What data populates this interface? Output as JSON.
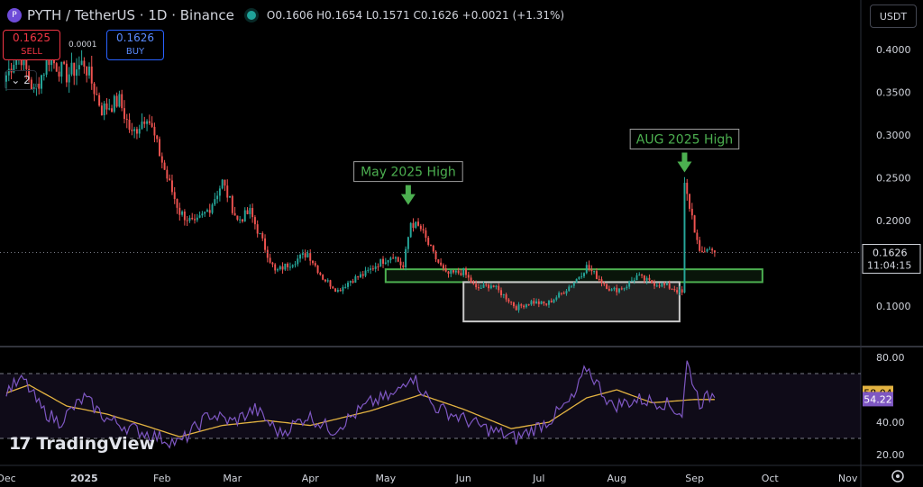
{
  "header": {
    "symbol": "PYTH / TetherUS · 1D · Binance",
    "ohlc": "O0.1606 H0.1654 L0.1571 C0.1626 +0.0021 (+1.31%)"
  },
  "currency_selector": "USDT",
  "sell": {
    "price": "0.1625",
    "label": "SELL"
  },
  "buy": {
    "price": "0.1626",
    "label": "BUY"
  },
  "spread": "0.0001",
  "indicator_count": "2",
  "collapse_icon": "chevron-down-icon",
  "watermark": "TradingView",
  "colors": {
    "up": "#26a69a",
    "down": "#ef5350",
    "rsi": "#7e57c2",
    "rsi_ma": "#e3b341",
    "annotation": "#4caf50",
    "box_green": "#4caf50",
    "box_gray": "#c8c8c8"
  },
  "chart_data": [
    {
      "type": "candlestick",
      "x_ticks": [
        "Dec",
        "2025",
        "Feb",
        "Mar",
        "Apr",
        "May",
        "Jun",
        "Jul",
        "Aug",
        "Sep",
        "Oct",
        "Nov"
      ],
      "y_ticks": [
        "0.4000",
        "0.3500",
        "0.3000",
        "0.2500",
        "0.2000",
        "0.1000"
      ],
      "ylim": [
        0.07,
        0.43
      ],
      "last_price": "0.1626",
      "countdown": "11:04:15",
      "annotations": [
        {
          "text": "May 2025 High",
          "date": "2025-05-10",
          "price": 0.212
        },
        {
          "text": "AUG 2025 High",
          "date": "2025-08-28",
          "price": 0.25
        }
      ],
      "zones": [
        {
          "color": "green",
          "from": "2025-05-01",
          "to": "2025-09-28",
          "low": 0.128,
          "high": 0.143
        },
        {
          "color": "gray",
          "from": "2025-06-01",
          "to": "2025-08-26",
          "low": 0.082,
          "high": 0.128
        }
      ],
      "price_path": [
        {
          "date": "2024-12-01",
          "price": 0.37
        },
        {
          "date": "2024-12-06",
          "price": 0.4
        },
        {
          "date": "2024-12-12",
          "price": 0.35
        },
        {
          "date": "2024-12-18",
          "price": 0.39
        },
        {
          "date": "2024-12-25",
          "price": 0.37
        },
        {
          "date": "2025-01-01",
          "price": 0.385
        },
        {
          "date": "2025-01-08",
          "price": 0.33
        },
        {
          "date": "2025-01-15",
          "price": 0.34
        },
        {
          "date": "2025-01-20",
          "price": 0.3
        },
        {
          "date": "2025-01-26",
          "price": 0.325
        },
        {
          "date": "2025-02-03",
          "price": 0.25
        },
        {
          "date": "2025-02-08",
          "price": 0.21
        },
        {
          "date": "2025-02-14",
          "price": 0.195
        },
        {
          "date": "2025-02-20",
          "price": 0.215
        },
        {
          "date": "2025-02-25",
          "price": 0.245
        },
        {
          "date": "2025-03-03",
          "price": 0.2
        },
        {
          "date": "2025-03-08",
          "price": 0.21
        },
        {
          "date": "2025-03-13",
          "price": 0.175
        },
        {
          "date": "2025-03-18",
          "price": 0.14
        },
        {
          "date": "2025-03-24",
          "price": 0.15
        },
        {
          "date": "2025-03-31",
          "price": 0.162
        },
        {
          "date": "2025-04-06",
          "price": 0.133
        },
        {
          "date": "2025-04-12",
          "price": 0.118
        },
        {
          "date": "2025-04-17",
          "price": 0.13
        },
        {
          "date": "2025-04-23",
          "price": 0.138
        },
        {
          "date": "2025-04-28",
          "price": 0.15
        },
        {
          "date": "2025-05-04",
          "price": 0.16
        },
        {
          "date": "2025-05-08",
          "price": 0.145
        },
        {
          "date": "2025-05-11",
          "price": 0.198
        },
        {
          "date": "2025-05-15",
          "price": 0.19
        },
        {
          "date": "2025-05-20",
          "price": 0.16
        },
        {
          "date": "2025-05-25",
          "price": 0.137
        },
        {
          "date": "2025-06-01",
          "price": 0.14
        },
        {
          "date": "2025-06-06",
          "price": 0.12
        },
        {
          "date": "2025-06-12",
          "price": 0.125
        },
        {
          "date": "2025-06-18",
          "price": 0.11
        },
        {
          "date": "2025-06-22",
          "price": 0.098
        },
        {
          "date": "2025-06-28",
          "price": 0.105
        },
        {
          "date": "2025-07-04",
          "price": 0.102
        },
        {
          "date": "2025-07-10",
          "price": 0.115
        },
        {
          "date": "2025-07-15",
          "price": 0.128
        },
        {
          "date": "2025-07-20",
          "price": 0.146
        },
        {
          "date": "2025-07-25",
          "price": 0.132
        },
        {
          "date": "2025-07-30",
          "price": 0.118
        },
        {
          "date": "2025-08-04",
          "price": 0.122
        },
        {
          "date": "2025-08-09",
          "price": 0.135
        },
        {
          "date": "2025-08-14",
          "price": 0.128
        },
        {
          "date": "2025-08-19",
          "price": 0.125
        },
        {
          "date": "2025-08-24",
          "price": 0.12
        },
        {
          "date": "2025-08-27",
          "price": 0.115
        },
        {
          "date": "2025-08-28",
          "price": 0.24
        },
        {
          "date": "2025-08-31",
          "price": 0.205
        },
        {
          "date": "2025-09-03",
          "price": 0.16
        },
        {
          "date": "2025-09-06",
          "price": 0.168
        },
        {
          "date": "2025-09-09",
          "price": 0.1626
        }
      ]
    },
    {
      "type": "line",
      "y_ticks": [
        "80.00",
        "40.00",
        "20.00"
      ],
      "ylim": [
        10,
        85
      ],
      "levels": [
        70,
        30
      ],
      "values": [
        "58.04",
        "54.22"
      ],
      "series": [
        {
          "role": "rsi",
          "points": [
            {
              "date": "2024-12-01",
              "value": 60
            },
            {
              "date": "2024-12-08",
              "value": 66
            },
            {
              "date": "2024-12-15",
              "value": 48
            },
            {
              "date": "2024-12-22",
              "value": 40
            },
            {
              "date": "2025-01-01",
              "value": 55
            },
            {
              "date": "2025-01-10",
              "value": 42
            },
            {
              "date": "2025-01-20",
              "value": 36
            },
            {
              "date": "2025-02-01",
              "value": 30
            },
            {
              "date": "2025-02-08",
              "value": 27
            },
            {
              "date": "2025-02-20",
              "value": 45
            },
            {
              "date": "2025-03-01",
              "value": 40
            },
            {
              "date": "2025-03-10",
              "value": 48
            },
            {
              "date": "2025-03-20",
              "value": 33
            },
            {
              "date": "2025-03-31",
              "value": 44
            },
            {
              "date": "2025-04-10",
              "value": 35
            },
            {
              "date": "2025-04-25",
              "value": 52
            },
            {
              "date": "2025-05-05",
              "value": 57
            },
            {
              "date": "2025-05-11",
              "value": 70
            },
            {
              "date": "2025-05-20",
              "value": 50
            },
            {
              "date": "2025-06-01",
              "value": 42
            },
            {
              "date": "2025-06-10",
              "value": 36
            },
            {
              "date": "2025-06-22",
              "value": 30
            },
            {
              "date": "2025-07-05",
              "value": 41
            },
            {
              "date": "2025-07-15",
              "value": 55
            },
            {
              "date": "2025-07-20",
              "value": 74
            },
            {
              "date": "2025-07-30",
              "value": 50
            },
            {
              "date": "2025-08-10",
              "value": 54
            },
            {
              "date": "2025-08-20",
              "value": 52
            },
            {
              "date": "2025-08-27",
              "value": 45
            },
            {
              "date": "2025-08-29",
              "value": 77
            },
            {
              "date": "2025-09-03",
              "value": 52
            },
            {
              "date": "2025-09-09",
              "value": 58
            }
          ]
        },
        {
          "role": "rsi-ma",
          "points": [
            {
              "date": "2024-12-01",
              "value": 58
            },
            {
              "date": "2024-12-10",
              "value": 63
            },
            {
              "date": "2024-12-25",
              "value": 50
            },
            {
              "date": "2025-01-10",
              "value": 45
            },
            {
              "date": "2025-01-25",
              "value": 38
            },
            {
              "date": "2025-02-08",
              "value": 31
            },
            {
              "date": "2025-02-25",
              "value": 38
            },
            {
              "date": "2025-03-15",
              "value": 41
            },
            {
              "date": "2025-04-01",
              "value": 38
            },
            {
              "date": "2025-04-25",
              "value": 47
            },
            {
              "date": "2025-05-15",
              "value": 57
            },
            {
              "date": "2025-06-01",
              "value": 48
            },
            {
              "date": "2025-06-20",
              "value": 36
            },
            {
              "date": "2025-07-05",
              "value": 40
            },
            {
              "date": "2025-07-20",
              "value": 55
            },
            {
              "date": "2025-08-01",
              "value": 60
            },
            {
              "date": "2025-08-15",
              "value": 52
            },
            {
              "date": "2025-09-01",
              "value": 54
            },
            {
              "date": "2025-09-09",
              "value": 54
            }
          ]
        }
      ]
    }
  ]
}
